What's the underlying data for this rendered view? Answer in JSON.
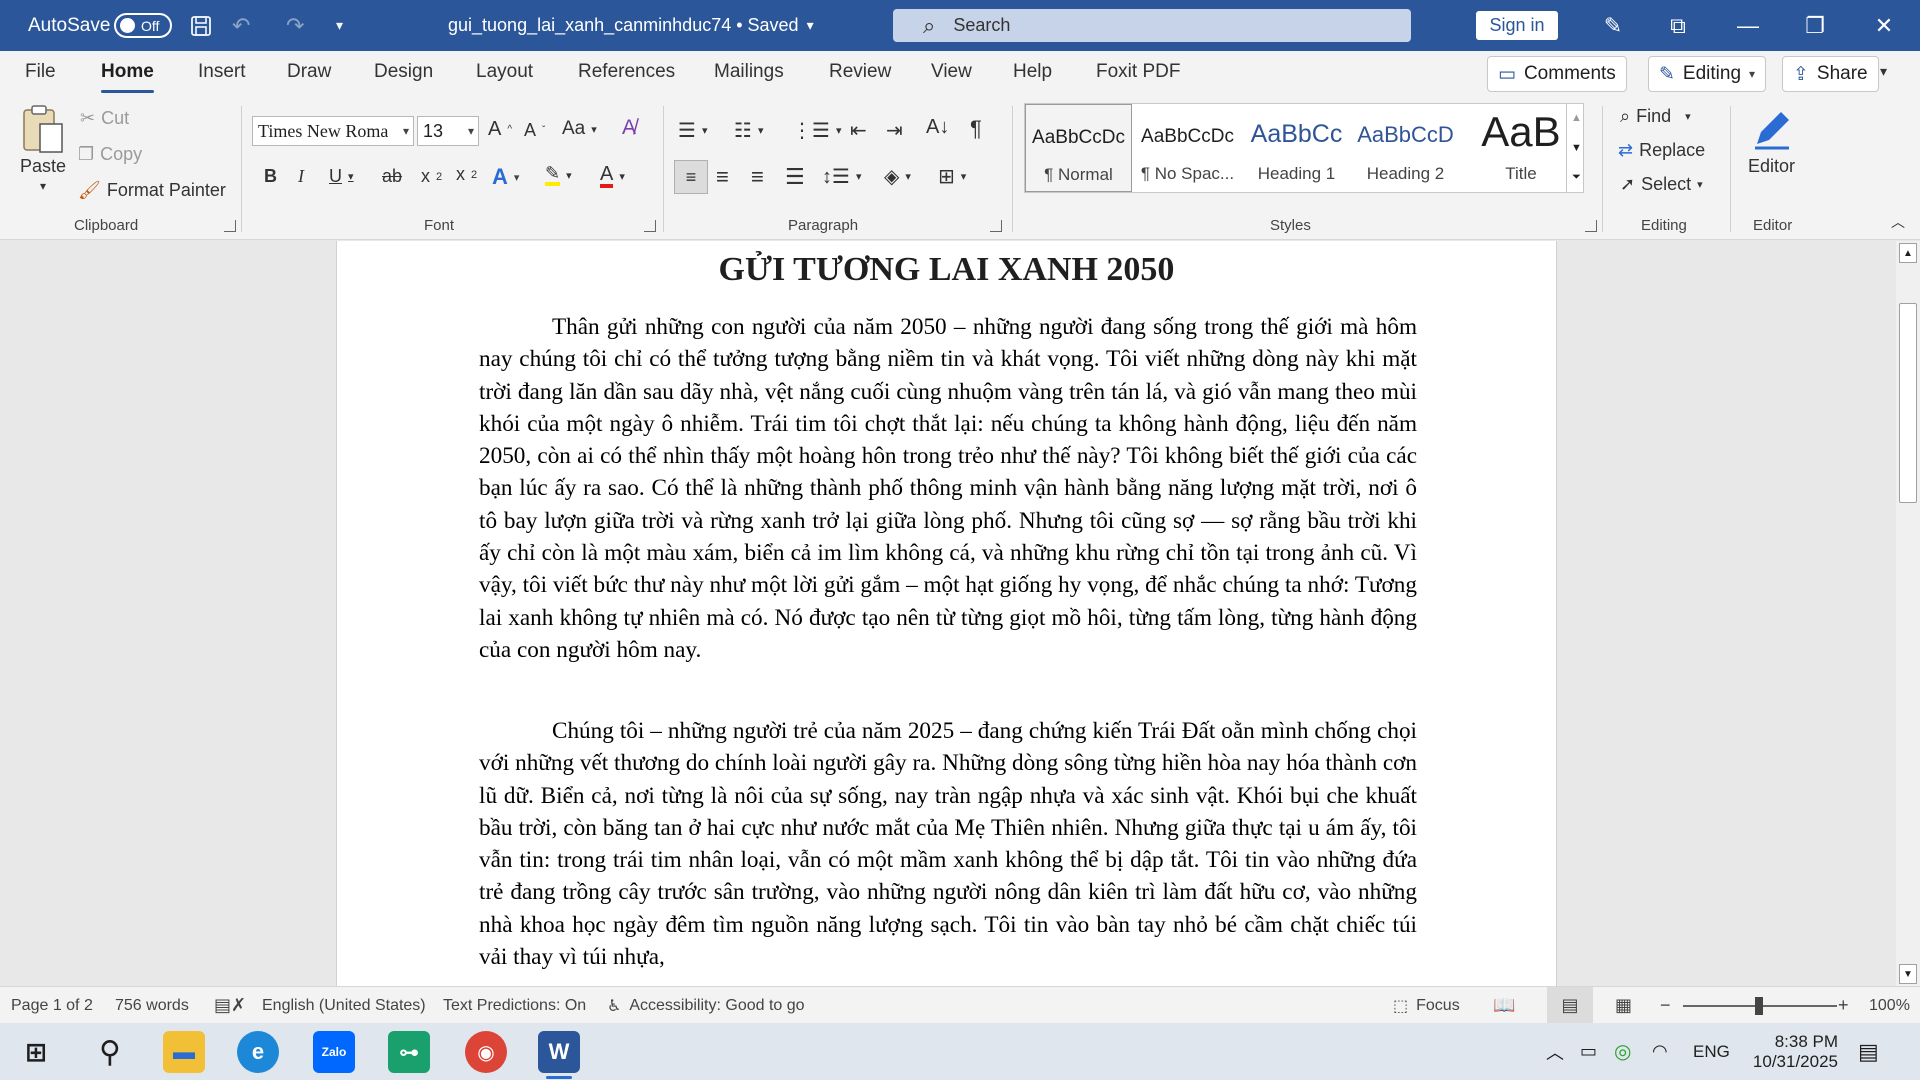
{
  "titlebar": {
    "autosave_label": "AutoSave",
    "autosave_state": "Off",
    "doc_title": "gui_tuong_lai_xanh_canminhduc74 • Saved",
    "search_placeholder": "Search",
    "signin_label": "Sign in"
  },
  "tabs": [
    {
      "label": "File"
    },
    {
      "label": "Home"
    },
    {
      "label": "Insert"
    },
    {
      "label": "Draw"
    },
    {
      "label": "Design"
    },
    {
      "label": "Layout"
    },
    {
      "label": "References"
    },
    {
      "label": "Mailings"
    },
    {
      "label": "Review"
    },
    {
      "label": "View"
    },
    {
      "label": "Help"
    },
    {
      "label": "Foxit PDF"
    }
  ],
  "ribbon_actions": {
    "comments": "Comments",
    "editing": "Editing",
    "share": "Share"
  },
  "clipboard": {
    "paste": "Paste",
    "cut": "Cut",
    "copy": "Copy",
    "format_painter": "Format Painter",
    "label": "Clipboard"
  },
  "font": {
    "family": "Times New Roma",
    "size": "13",
    "label": "Font"
  },
  "paragraph": {
    "label": "Paragraph"
  },
  "styles": {
    "label": "Styles",
    "items": [
      {
        "sample": "AaBbCcDc",
        "name": "¶ Normal"
      },
      {
        "sample": "AaBbCcDc",
        "name": "¶ No Spac..."
      },
      {
        "sample": "AaBbCc",
        "name": "Heading 1"
      },
      {
        "sample": "AaBbCcD",
        "name": "Heading 2"
      },
      {
        "sample": "AaB",
        "name": "Title"
      }
    ]
  },
  "editing_group": {
    "find": "Find",
    "replace": "Replace",
    "select": "Select",
    "label": "Editing"
  },
  "editor_group": {
    "button": "Editor",
    "label": "Editor"
  },
  "document": {
    "title": "GỬI TƯƠNG LAI XANH 2050",
    "paragraphs": [
      "Thân gửi những con người của năm 2050 – những người đang sống trong thế giới mà hôm nay chúng tôi chỉ có thể tưởng tượng bằng niềm tin và khát vọng. Tôi viết những dòng này khi mặt trời đang lăn dần sau dãy nhà, vệt nắng cuối cùng nhuộm vàng trên tán lá, và gió vẫn mang theo mùi khói của một ngày ô nhiễm. Trái tim tôi chợt thắt lại: nếu chúng ta không hành động, liệu đến năm 2050, còn ai có thể nhìn thấy một hoàng hôn trong trẻo như thế này? Tôi không biết thế giới của các bạn lúc ấy ra sao. Có thể là những thành phố thông minh vận hành bằng năng lượng mặt trời, nơi ô tô bay lượn giữa trời và rừng xanh trở lại giữa lòng phố. Nhưng tôi cũng sợ — sợ rằng bầu trời khi ấy chỉ còn là một màu xám, biển cả im lìm không cá, và những khu rừng chỉ tồn tại trong ảnh cũ. Vì vậy, tôi viết bức thư này như một lời gửi gắm – một hạt giống hy vọng, để nhắc chúng ta nhớ: Tương lai xanh không tự nhiên mà có. Nó được tạo nên từ từng giọt mồ hôi, từng tấm lòng, từng hành động của con người hôm nay.",
      "Chúng tôi – những người trẻ của năm 2025 – đang chứng kiến Trái Đất oằn mình chống chọi với những vết thương do chính loài người gây ra. Những dòng sông từng hiền hòa nay hóa thành cơn lũ dữ. Biển cả, nơi từng là nôi của sự sống, nay tràn ngập nhựa và xác sinh vật. Khói bụi che khuất bầu trời, còn băng tan ở hai cực như nước mắt của Mẹ Thiên nhiên. Nhưng giữa thực tại u ám ấy, tôi vẫn tin: trong trái tim nhân loại, vẫn có một mầm xanh không thể bị dập tắt. Tôi tin vào những đứa trẻ đang trồng cây trước sân trường, vào những người nông dân kiên trì làm đất hữu cơ, vào những nhà khoa học ngày đêm tìm nguồn năng lượng sạch. Tôi tin vào bàn tay nhỏ bé cầm chặt chiếc túi vải thay vì túi nhựa,"
    ]
  },
  "statusbar": {
    "page": "Page 1 of 2",
    "words": "756 words",
    "language": "English (United States)",
    "predictions": "Text Predictions: On",
    "accessibility": "Accessibility: Good to go",
    "focus": "Focus",
    "zoom": "100%"
  },
  "taskbar": {
    "time": "8:38 PM",
    "date": "10/31/2025",
    "lang": "ENG",
    "zalo_label": "Zalo"
  },
  "colors": {
    "word_blue": "#2b579a",
    "squiggle": "#d8382f"
  }
}
